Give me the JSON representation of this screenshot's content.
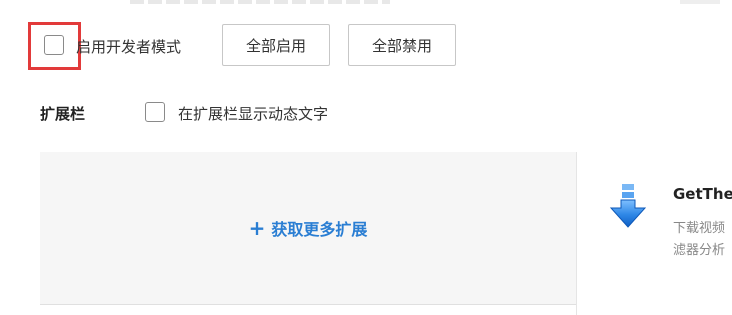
{
  "developer_mode": {
    "label": "启用开发者模式",
    "checked": false,
    "enable_all_label": "全部启用",
    "disable_all_label": "全部禁用"
  },
  "toolbar": {
    "title": "扩展栏",
    "checkbox_label": "在扩展栏显示动态文字",
    "checked": false
  },
  "get_more": {
    "icon": "plus-icon",
    "label": "获取更多扩展"
  },
  "extension": {
    "icon": "download-arrow-icon",
    "name": "GetThe",
    "description_line1": "下载视频",
    "description_line2": "滤器分析"
  },
  "colors": {
    "highlight": "#e23a3a",
    "link": "#2a7ed3",
    "panel": "#f6f6f6"
  }
}
